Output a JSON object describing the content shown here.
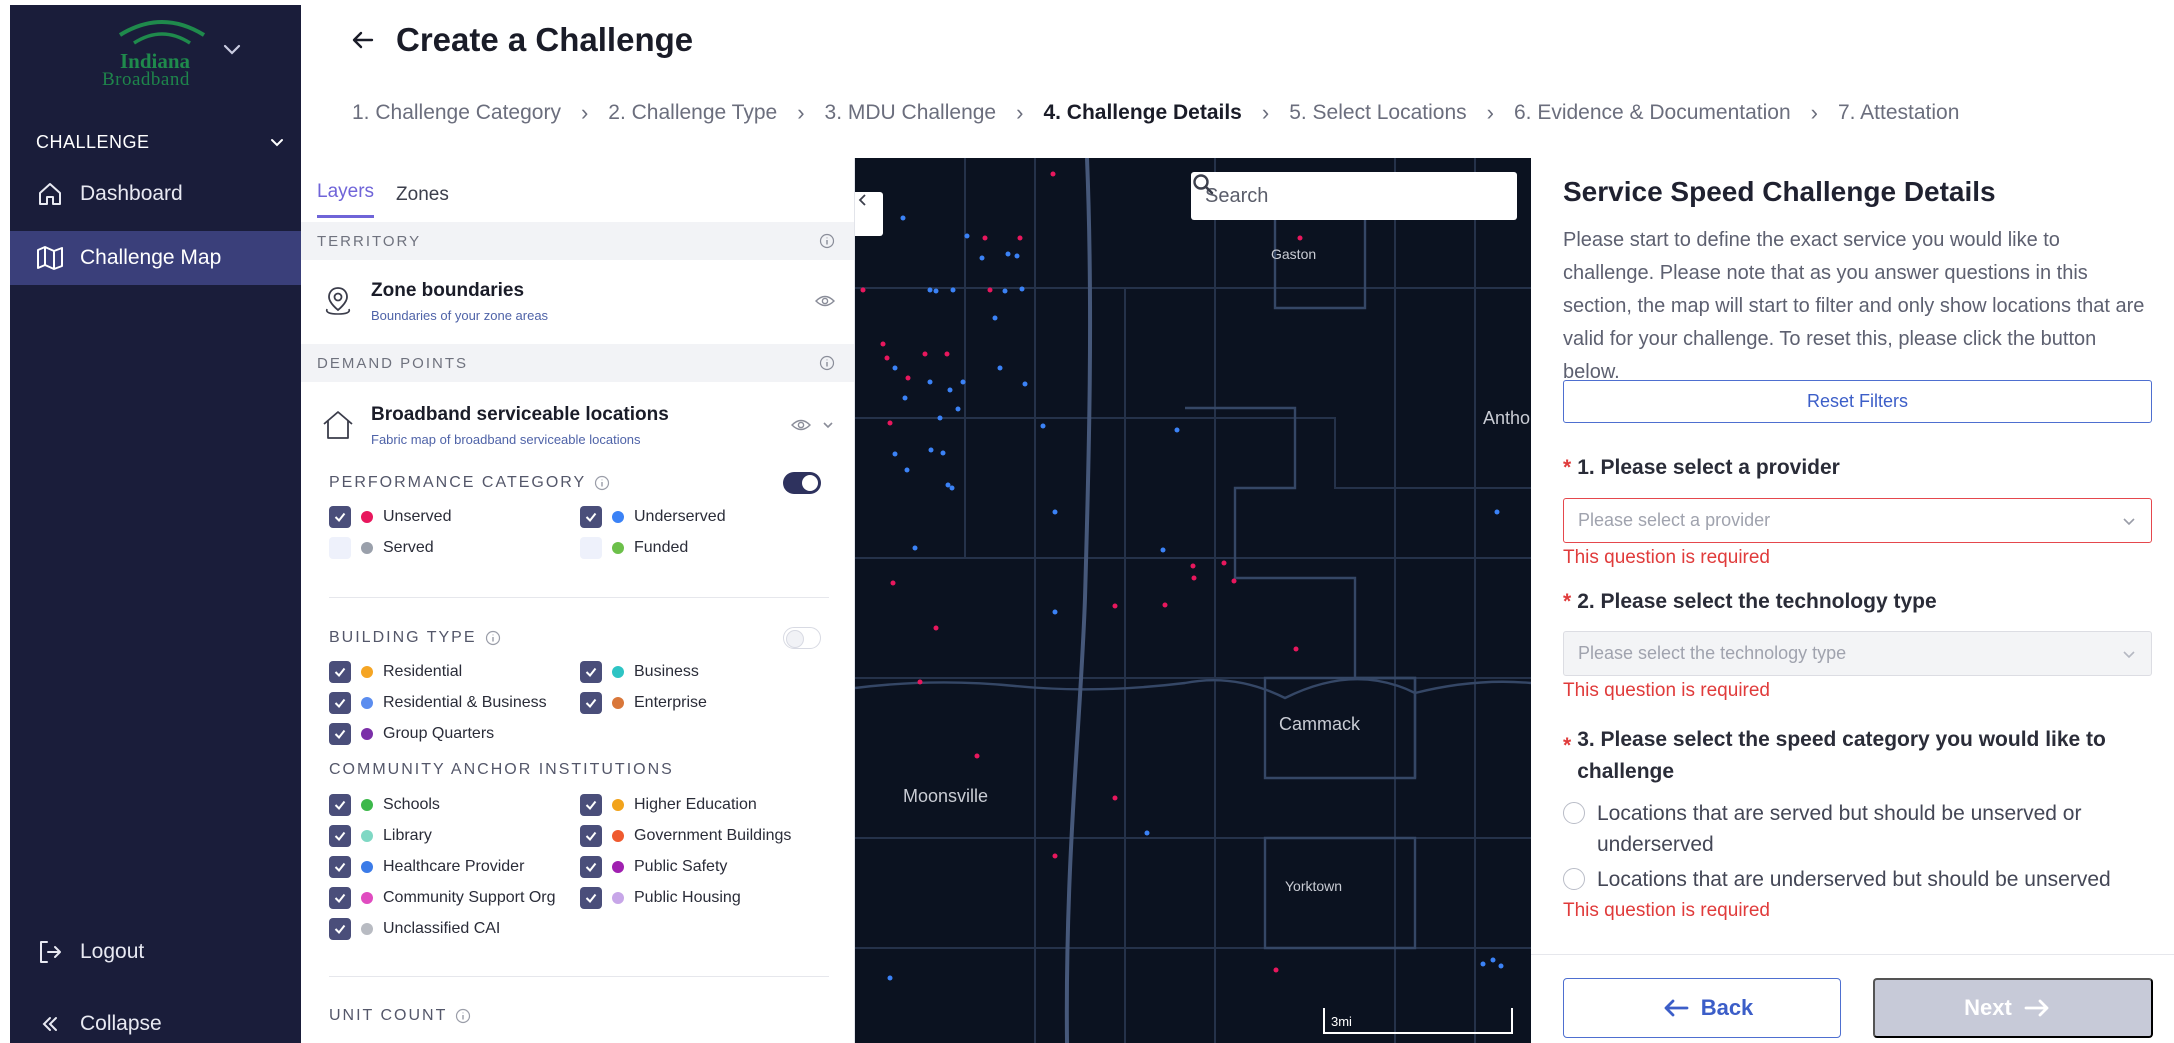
{
  "app": {
    "logo_line1": "Indiana",
    "logo_line2": "Broadband",
    "brand_green": "#1f8a4c",
    "sidebar_bg": "#1a1d3a",
    "accent": "#6f64d8"
  },
  "sidebar": {
    "section": "CHALLENGE",
    "items": [
      {
        "label": "Dashboard",
        "icon": "home-icon",
        "active": false
      },
      {
        "label": "Challenge Map",
        "icon": "map-icon",
        "active": true
      }
    ],
    "logout": "Logout",
    "collapse": "Collapse"
  },
  "header": {
    "title": "Create a Challenge",
    "steps": [
      {
        "label": "1. Challenge Category",
        "active": false
      },
      {
        "label": "2. Challenge Type",
        "active": false
      },
      {
        "label": "3. MDU Challenge",
        "active": false
      },
      {
        "label": "4. Challenge Details",
        "active": true
      },
      {
        "label": "5. Select Locations",
        "active": false
      },
      {
        "label": "6. Evidence & Documentation",
        "active": false
      },
      {
        "label": "7. Attestation",
        "active": false
      }
    ]
  },
  "layers": {
    "tabs": [
      {
        "label": "Layers",
        "active": true
      },
      {
        "label": "Zones",
        "active": false
      }
    ],
    "territory_header": "TERRITORY",
    "zone_layer": {
      "name": "Zone boundaries",
      "sub": "Boundaries of your zone areas"
    },
    "demand_header": "DEMAND POINTS",
    "bsl_layer": {
      "name": "Broadband serviceable locations",
      "sub": "Fabric map of broadband serviceable locations"
    },
    "performance": {
      "title": "PERFORMANCE CATEGORY",
      "toggle_on": true,
      "items": [
        {
          "label": "Unserved",
          "checked": true,
          "color": "#e8175d"
        },
        {
          "label": "Underserved",
          "checked": true,
          "color": "#3b82f6"
        },
        {
          "label": "Served",
          "checked": false,
          "color": "#9aa0ab"
        },
        {
          "label": "Funded",
          "checked": false,
          "color": "#6cc04a"
        }
      ]
    },
    "building": {
      "title": "BUILDING TYPE",
      "toggle_on": false,
      "items": [
        {
          "label": "Residential",
          "checked": true,
          "color": "#f5a524"
        },
        {
          "label": "Business",
          "checked": true,
          "color": "#2ec4c4"
        },
        {
          "label": "Residential & Business",
          "checked": true,
          "color": "#5b8def"
        },
        {
          "label": "Enterprise",
          "checked": true,
          "color": "#d9773a"
        },
        {
          "label": "Group Quarters",
          "checked": true,
          "color": "#7b2fa8"
        }
      ]
    },
    "anchor": {
      "title": "COMMUNITY ANCHOR INSTITUTIONS",
      "items": [
        {
          "label": "Schools",
          "checked": true,
          "color": "#3cb84a"
        },
        {
          "label": "Higher Education",
          "checked": true,
          "color": "#f2a31b"
        },
        {
          "label": "Library",
          "checked": true,
          "color": "#7fd8c4"
        },
        {
          "label": "Government Buildings",
          "checked": true,
          "color": "#ef5a2f"
        },
        {
          "label": "Healthcare Provider",
          "checked": true,
          "color": "#3b7be8"
        },
        {
          "label": "Public Safety",
          "checked": true,
          "color": "#a020b0"
        },
        {
          "label": "Community Support Org",
          "checked": true,
          "color": "#e04cc0"
        },
        {
          "label": "Public Housing",
          "checked": true,
          "color": "#c7a6e8"
        },
        {
          "label": "Unclassified CAI",
          "checked": true,
          "color": "#b8bbc2"
        }
      ]
    },
    "unit_count": "UNIT COUNT"
  },
  "map": {
    "search_placeholder": "Search",
    "labels": {
      "gaston": "Gaston",
      "anthony": "Antho",
      "cammack": "Cammack",
      "moonsville": "Moonsville",
      "yorktown": "Yorktown"
    },
    "scale": "3mi"
  },
  "details": {
    "title": "Service Speed Challenge Details",
    "description": "Please start to define the exact service you would like to challenge. Please note that as you answer questions in this section, the map will start to filter and only show locations that are valid for your challenge. To reset this, please click the button below.",
    "reset_label": "Reset Filters",
    "q1": {
      "label": "1. Please select a provider",
      "placeholder": "Please select a provider",
      "error": "This question is required"
    },
    "q2": {
      "label": "2. Please select the technology type",
      "placeholder": "Please select the technology type",
      "error": "This question is required"
    },
    "q3": {
      "label_line1": "3. Please select the speed category you would like to",
      "label_line2": "challenge",
      "options": [
        "Locations that are served but should be unserved or underserved",
        "Locations that are underserved but should be unserved"
      ],
      "error": "This question is required"
    },
    "back_label": "Back",
    "next_label": "Next"
  }
}
